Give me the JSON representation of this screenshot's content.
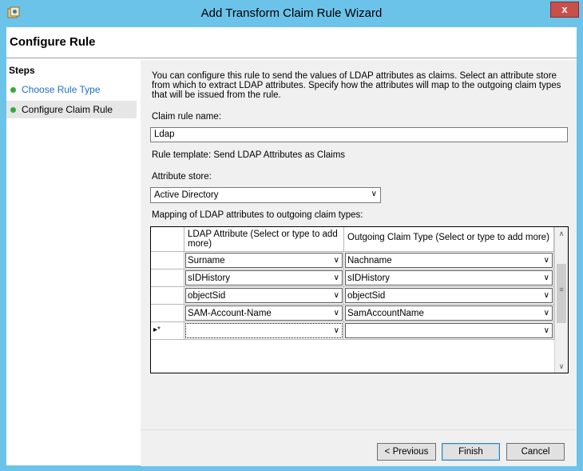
{
  "window": {
    "title": "Add Transform Claim Rule Wizard",
    "close_label": "x",
    "icon": "wizard-app-icon"
  },
  "header": {
    "title": "Configure Rule"
  },
  "steps": {
    "title": "Steps",
    "items": [
      {
        "label": "Choose Rule Type",
        "status": "done"
      },
      {
        "label": "Configure Claim Rule",
        "status": "current"
      }
    ]
  },
  "main": {
    "intro": "You can configure this rule to send the values of LDAP attributes as claims. Select an attribute store from which to extract LDAP attributes. Specify how the attributes will map to the outgoing claim types that will be issued from the rule.",
    "rule_name_label": "Claim rule name:",
    "rule_name_value": "Ldap",
    "rule_template": "Rule template: Send LDAP Attributes as Claims",
    "attribute_store_label": "Attribute store:",
    "attribute_store_value": "Active Directory",
    "mapping_label": "Mapping of LDAP attributes to outgoing claim types:"
  },
  "mapping_table": {
    "columns": [
      "LDAP Attribute (Select or type to add more)",
      "Outgoing Claim Type (Select or type to add more)"
    ],
    "new_row_marker": "▸*",
    "rows": [
      {
        "ldap": "Surname",
        "claim": "Nachname"
      },
      {
        "ldap": "sIDHistory",
        "claim": "sIDHistory"
      },
      {
        "ldap": "objectSid",
        "claim": "objectSid"
      },
      {
        "ldap": "SAM-Account-Name",
        "claim": "SamAccountName"
      },
      {
        "ldap": "",
        "claim": ""
      }
    ]
  },
  "buttons": {
    "previous": "< Previous",
    "finish": "Finish",
    "cancel": "Cancel"
  },
  "colors": {
    "titlebar": "#6cc3ea",
    "close": "#c7504a",
    "step_done": "#3aa83a",
    "link": "#1a6fc6"
  }
}
